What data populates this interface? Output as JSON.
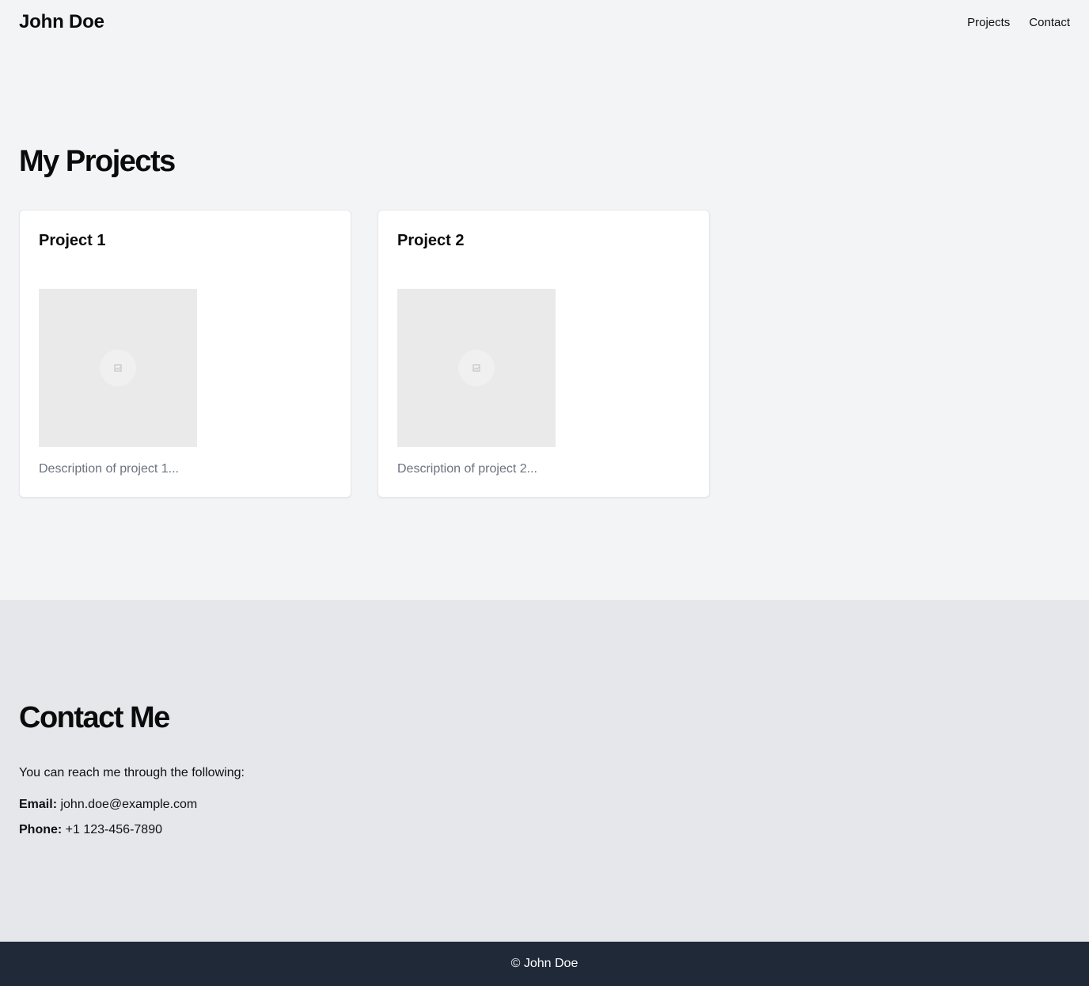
{
  "header": {
    "brand": "John Doe",
    "nav": [
      {
        "label": "Projects"
      },
      {
        "label": "Contact"
      }
    ]
  },
  "projects": {
    "title": "My Projects",
    "items": [
      {
        "title": "Project 1",
        "description": "Description of project 1...",
        "image_icon": "image-placeholder-icon"
      },
      {
        "title": "Project 2",
        "description": "Description of project 2...",
        "image_icon": "image-placeholder-icon"
      }
    ]
  },
  "contact": {
    "title": "Contact Me",
    "intro": "You can reach me through the following:",
    "email_label": "Email:",
    "email_value": "john.doe@example.com",
    "phone_label": "Phone:",
    "phone_value": "+1 123-456-7890"
  },
  "footer": {
    "text": "© John Doe"
  },
  "colors": {
    "page_background": "#f3f4f6",
    "contact_background": "#e5e7eb",
    "footer_background": "#1f2937",
    "card_background": "#ffffff",
    "image_placeholder": "#eaeaea",
    "muted_text": "#6b7280"
  }
}
